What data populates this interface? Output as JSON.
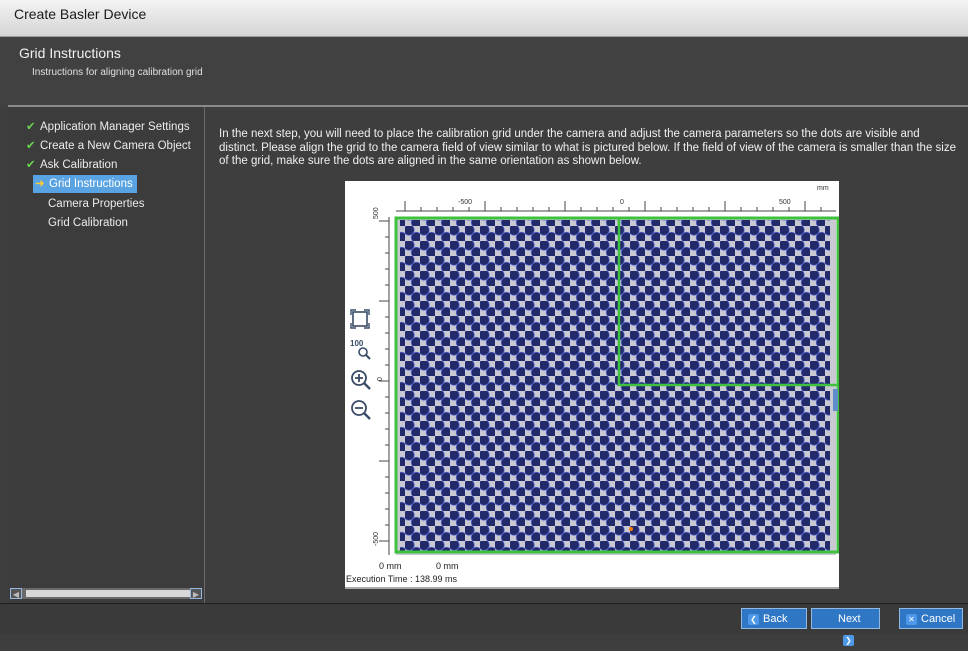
{
  "window": {
    "title": "Create Basler Device"
  },
  "header": {
    "title": "Grid Instructions",
    "subtitle": "Instructions for aligning calibration grid"
  },
  "steps": [
    {
      "label": "Application Manager Settings",
      "state": "done"
    },
    {
      "label": "Create a New Camera Object",
      "state": "done"
    },
    {
      "label": "Ask Calibration",
      "state": "done"
    },
    {
      "label": "Grid Instructions",
      "state": "current"
    },
    {
      "label": "Camera Properties",
      "state": "pending"
    },
    {
      "label": "Grid Calibration",
      "state": "pending"
    }
  ],
  "instructions": "In the next step, you will need to place the calibration grid under the camera and adjust the camera parameters so the dots are visible and distinct. Please align the grid to the camera field of view similar to what is pictured below. If the field of view of the camera is smaller than the size of the grid, make sure the dots are aligned in the same orientation as shown below.",
  "viewer": {
    "unit": "mm",
    "x_ticks": [
      "-500",
      "0",
      "500"
    ],
    "y_ticks": [
      "500",
      "0",
      "-500"
    ],
    "readout_x": "0 mm",
    "readout_y": "0 mm",
    "execution_time": "Execution Time : 138.99 ms",
    "tools": [
      {
        "name": "fit-to-window-icon"
      },
      {
        "name": "zoom-100-icon",
        "text": "100"
      },
      {
        "name": "zoom-in-icon"
      },
      {
        "name": "zoom-out-icon"
      }
    ],
    "colors": {
      "guide": "#3ec23e",
      "dot": "#232a6a",
      "grid_bg": "#c9c9d4"
    }
  },
  "footer": {
    "back": "Back",
    "next": "Next",
    "cancel": "Cancel"
  },
  "colors": {
    "accent": "#2f77c5",
    "selection": "#59a3e2",
    "check": "#6bd44f"
  }
}
